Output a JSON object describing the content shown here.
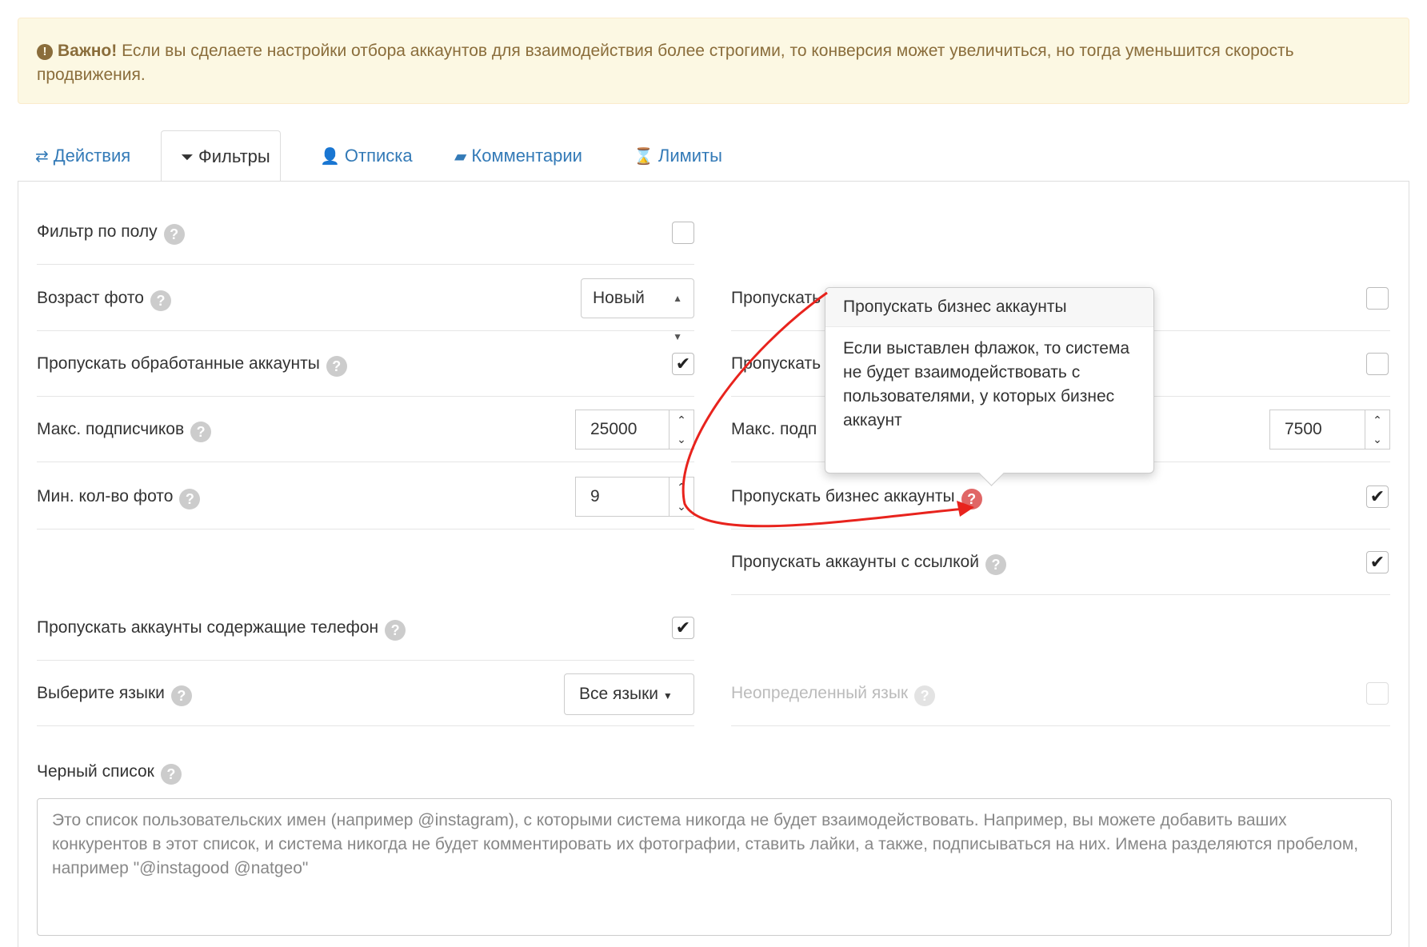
{
  "alert": {
    "strong": "Важно!",
    "text": " Если вы сделаете настройки отбора аккаунтов для взаимодействия более строгими, то конверсия может увеличиться, но тогда уменьшится скорость продвижения."
  },
  "tabs": [
    {
      "label": "Действия",
      "icon": "exchange-icon"
    },
    {
      "label": "Фильтры",
      "icon": "filter-icon"
    },
    {
      "label": "Отписка",
      "icon": "user-remove-icon"
    },
    {
      "label": "Комментарии",
      "icon": "comment-icon"
    },
    {
      "label": "Лимиты",
      "icon": "hourglass-icon"
    }
  ],
  "left": {
    "gender_filter": "Фильтр по полу",
    "photo_age": "Возраст фото",
    "photo_age_value": "Новый",
    "skip_processed": "Пропускать обработанные аккаунты",
    "max_followers": "Макс. подписчиков",
    "max_followers_value": "25000",
    "min_photos": "Мин. кол-во фото",
    "min_photos_value": "9",
    "skip_phone": "Пропускать аккаунты содержащие телефон",
    "languages": "Выберите языки",
    "languages_value": "Все языки"
  },
  "right": {
    "row1_label": "Пропускать",
    "row2_label": "Пропускать",
    "max_label": "Макс. подп",
    "max_value": "7500",
    "skip_business": "Пропускать бизнес аккаунты",
    "skip_link": "Пропускать аккаунты с ссылкой",
    "undefined_language": "Неопределенный язык"
  },
  "help_mark": "?",
  "checkmark": "✔",
  "blacklist": {
    "label": "Черный список",
    "placeholder": "Это список пользовательских имен (например @instagram), с которыми система никогда не будет взаимодействовать. Например, вы можете добавить ваших конкурентов в этот список, и система никогда не будет комментировать их фотографии, ставить лайки, а также, подписываться на них. Имена разделяются пробелом, например \"@instagood @natgeo\""
  },
  "tooltip": {
    "title": "Пропускать бизнес аккаунты",
    "body": "Если выставлен флажок, то система не будет взаимодействовать с пользователями, у которых бизнес аккаунт"
  },
  "colors": {
    "link": "#337ab7",
    "alert_bg": "#fcf8e3",
    "alert_text": "#8a6d3b",
    "annotation_arrow": "#e8231d"
  }
}
